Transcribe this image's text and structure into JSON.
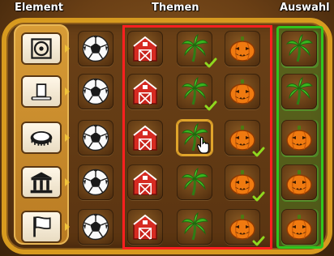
{
  "headers": {
    "element": "Element",
    "themen": "Themen",
    "auswahl": "Auswahl"
  },
  "colors": {
    "frame": "#d79a1f",
    "red_outline": "#ff1f1f",
    "green_outline": "#31c51c",
    "check": "#8fd81f"
  },
  "rows": [
    {
      "element": "target-icon",
      "ball": "soccer-ball-icon",
      "themes": [
        "barn-icon",
        "palm-icon",
        "pumpkin-icon"
      ],
      "checked": "palm",
      "auswahl": "palm-icon"
    },
    {
      "element": "hat-icon",
      "ball": "soccer-ball-icon",
      "themes": [
        "barn-icon",
        "palm-icon",
        "pumpkin-icon"
      ],
      "checked": "palm",
      "auswahl": "palm-icon"
    },
    {
      "element": "ring-icon",
      "ball": "soccer-ball-icon",
      "themes": [
        "barn-icon",
        "palm-icon",
        "pumpkin-icon"
      ],
      "checked": "pumpkin",
      "selected": "palm",
      "auswahl": "pumpkin-icon"
    },
    {
      "element": "temple-icon",
      "ball": "soccer-ball-icon",
      "themes": [
        "barn-icon",
        "palm-icon",
        "pumpkin-icon"
      ],
      "checked": "pumpkin",
      "auswahl": "pumpkin-icon"
    },
    {
      "element": "flag-icon",
      "ball": "soccer-ball-icon",
      "themes": [
        "barn-icon",
        "palm-icon",
        "pumpkin-icon"
      ],
      "checked": "pumpkin",
      "auswahl": "pumpkin-icon"
    }
  ]
}
